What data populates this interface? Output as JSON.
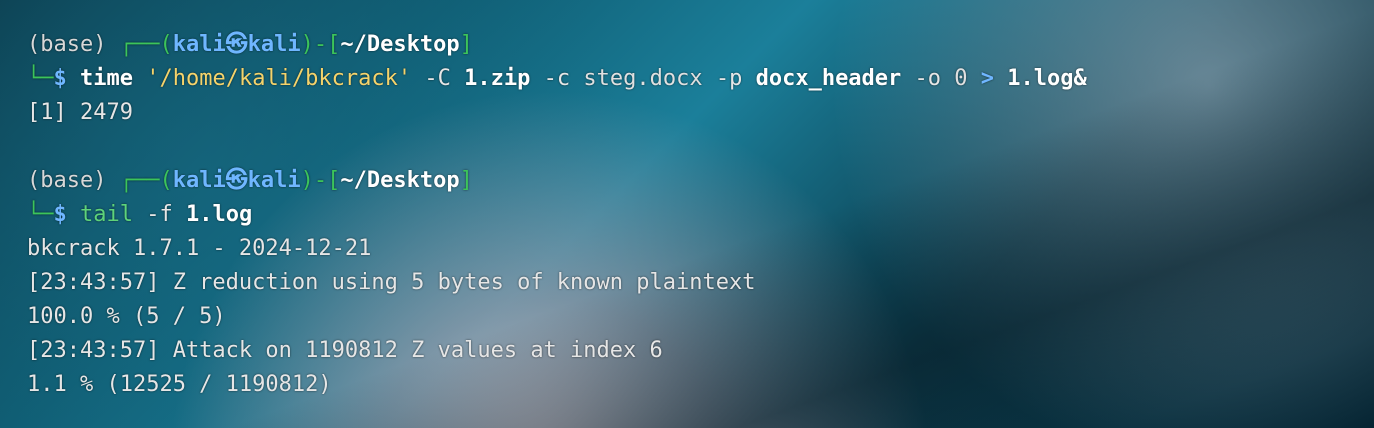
{
  "prompt1": {
    "env": "(base) ",
    "corner": "┌──(",
    "user": "kali㉿kali",
    "open": ")-[",
    "dir": "~/Desktop",
    "close": "]",
    "turn": "└─",
    "dollar": "$",
    "command": {
      "time": "time",
      "path": "'/home/kali/bkcrack'",
      "flagC": "-C",
      "zip": "1.zip",
      "flagc": "-c",
      "docx": "steg.docx",
      "flagp": "-p",
      "plain": "docx_header",
      "flago": "-o",
      "offset": "0",
      "redir": ">",
      "log": "1.log&"
    }
  },
  "job_line": "[1] 2479",
  "prompt2": {
    "env": "(base) ",
    "corner": "┌──(",
    "user": "kali㉿kali",
    "open": ")-[",
    "dir": "~/Desktop",
    "close": "]",
    "turn": "└─",
    "dollar": "$",
    "command": {
      "tail": "tail",
      "flagf": "-f",
      "log": "1.log"
    }
  },
  "output": [
    "bkcrack 1.7.1 - 2024-12-21",
    "[23:43:57] Z reduction using 5 bytes of known plaintext",
    "100.0 % (5 / 5)",
    "[23:43:57] Attack on 1190812 Z values at index 6",
    "1.1 % (12525 / 1190812)"
  ]
}
